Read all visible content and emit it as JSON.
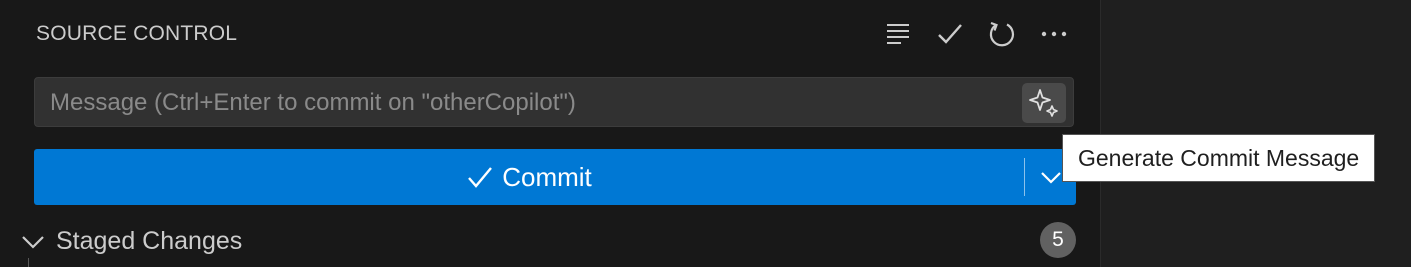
{
  "header": {
    "title": "SOURCE CONTROL",
    "actions": [
      {
        "icon": "view-as-list-icon",
        "label": "View as List"
      },
      {
        "icon": "check-icon",
        "label": "Commit"
      },
      {
        "icon": "refresh-icon",
        "label": "Refresh"
      },
      {
        "icon": "more-actions-icon",
        "label": "More Actions"
      }
    ]
  },
  "message": {
    "placeholder": "Message (Ctrl+Enter to commit on \"otherCopilot\")",
    "value": "",
    "generate_icon": "sparkle-icon"
  },
  "commit_button": {
    "label": "Commit",
    "icon": "check-icon",
    "dropdown_icon": "chevron-down-icon"
  },
  "tooltip": {
    "text": "Generate Commit Message"
  },
  "staged": {
    "label": "Staged Changes",
    "count": "5",
    "expanded": true
  },
  "colors": {
    "background": "#181818",
    "accent": "#0078d4",
    "input_bg": "#313131",
    "text": "#cccccc",
    "badge": "#616161"
  }
}
